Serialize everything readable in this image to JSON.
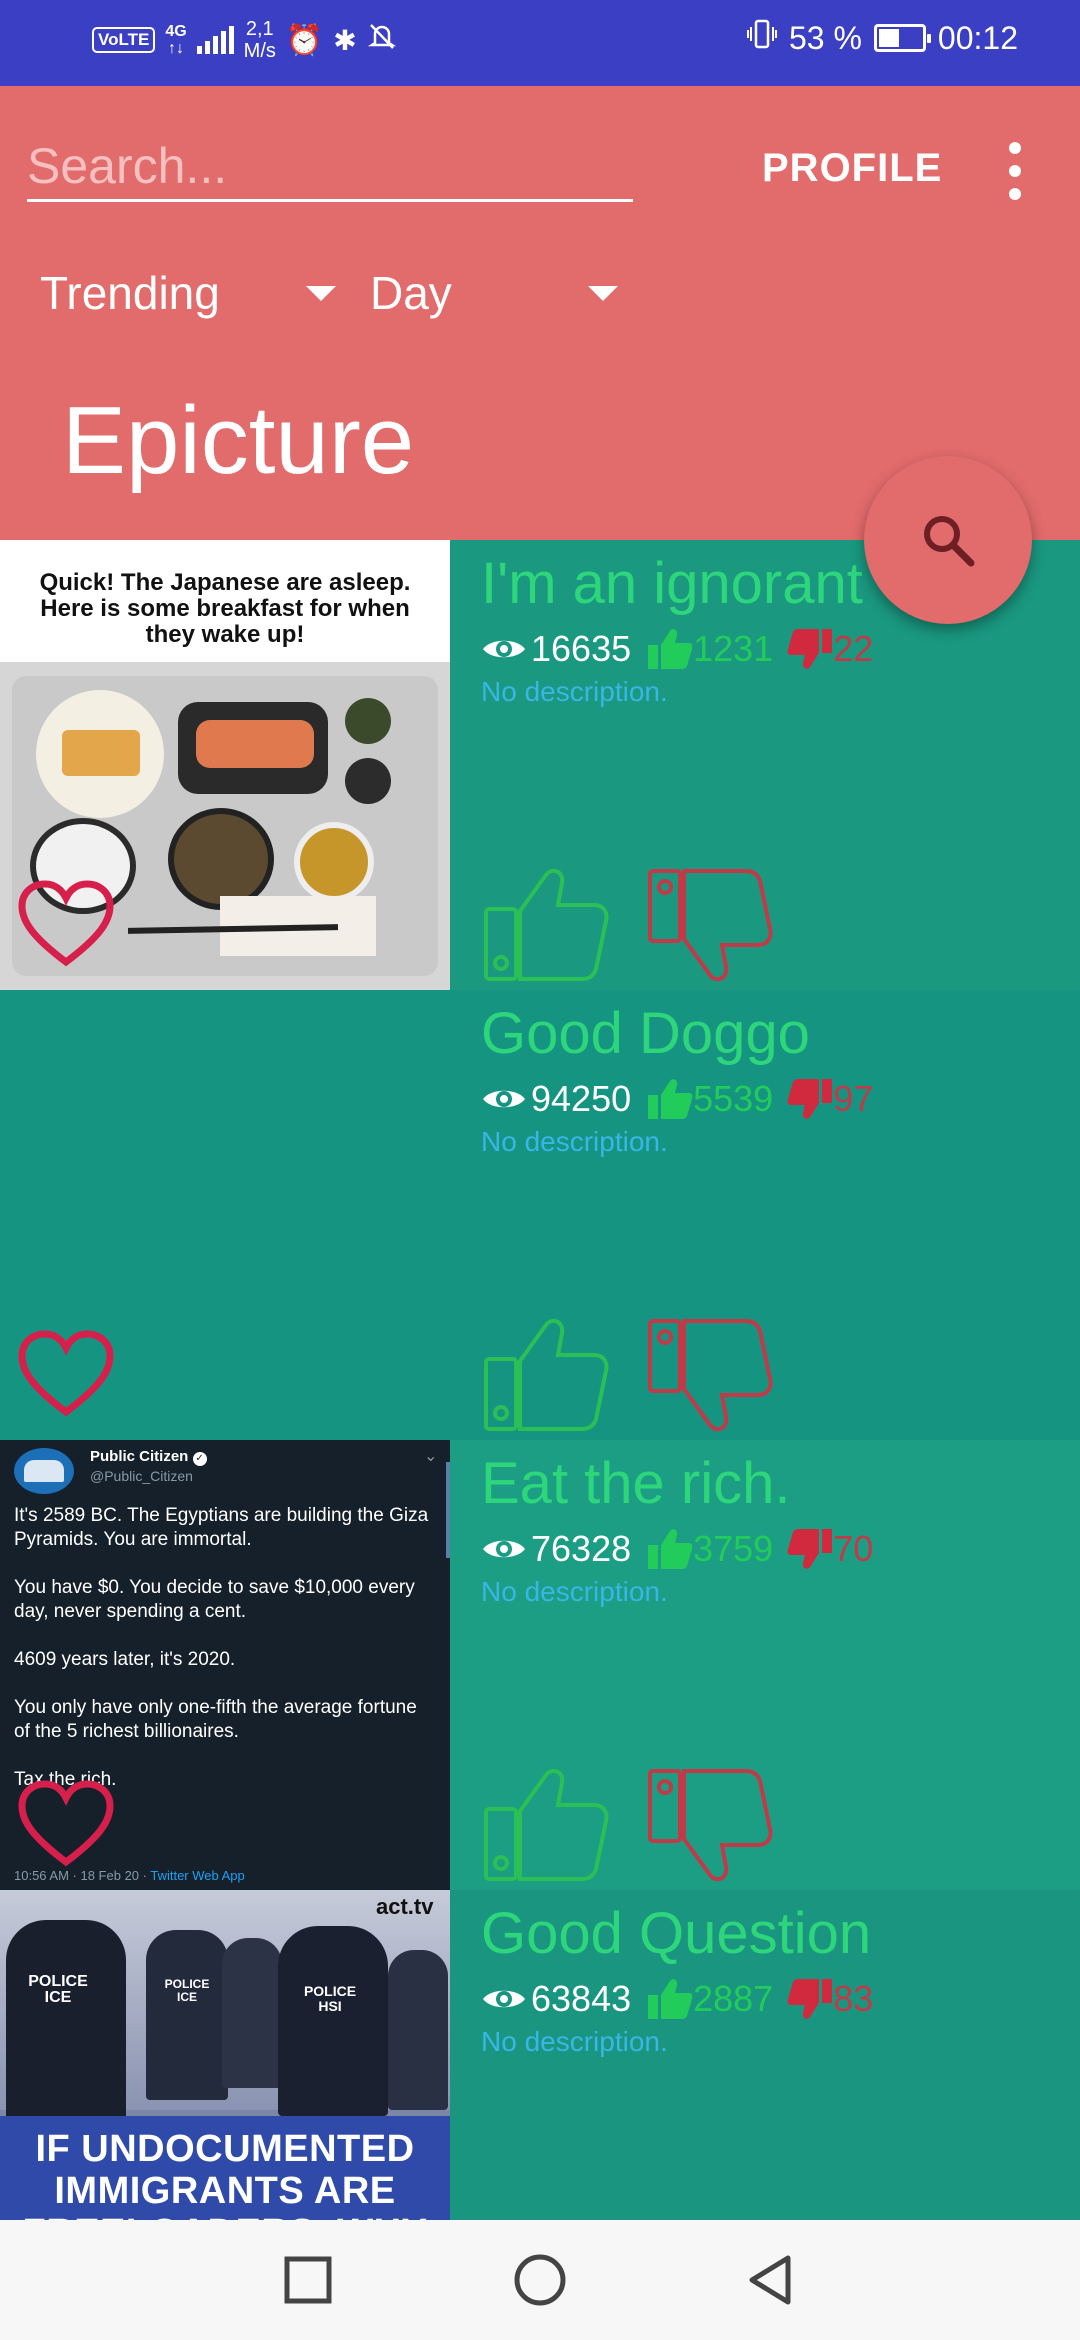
{
  "status_bar": {
    "volte": "VoLTE",
    "network": "4G",
    "speed_value": "2,1",
    "speed_unit": "M/s",
    "battery": "53 %",
    "battery_level": 0.53,
    "time": "00:12"
  },
  "header": {
    "search_placeholder": "Search...",
    "profile_label": "PROFILE",
    "sort_selected": "Trending",
    "window_selected": "Day",
    "app_title": "Epicture"
  },
  "posts": [
    {
      "title": "I'm an ignorant",
      "views": "16635",
      "upvotes": "1231",
      "downvotes": "22",
      "description": "No description.",
      "image_text": "Quick! The Japanese are asleep.  Here is some breakfast for when they wake up!"
    },
    {
      "title": "Good Doggo",
      "views": "94250",
      "upvotes": "5539",
      "downvotes": "97",
      "description": "No description."
    },
    {
      "title": "Eat the rich.",
      "views": "76328",
      "upvotes": "3759",
      "downvotes": "70",
      "description": "No description.",
      "tweet": {
        "name": "Public Citizen",
        "handle": "@Public_Citizen",
        "p1": "It's 2589 BC. The Egyptians are building the Giza Pyramids. You are immortal.",
        "p2": "You have $0. You decide to save $10,000 every day, never spending a cent.",
        "p3": "4609 years later, it's 2020.",
        "p4": "You only have only one-fifth the average fortune of the 5 richest billionaires.",
        "p5": "Tax the rich.",
        "meta": "10:56 AM · 18 Feb 20 · ",
        "source": "Twitter Web App"
      }
    },
    {
      "title": "Good Question",
      "views": "63843",
      "upvotes": "2887",
      "downvotes": "83",
      "description": "No description.",
      "image_text": "IF UNDOCUMENTED IMMIGRANTS ARE FREELOADERS, WHY",
      "watermark": "act.tv",
      "vest_1": "POLICE ICE",
      "vest_2": "POLICE ICE",
      "vest_3": "POLICE HSI"
    }
  ],
  "colors": {
    "header_bg": "#e26b6b",
    "status_bar_bg": "#3b3fc4",
    "list_bg": "#1a9a82",
    "title_green": "#2ed67b",
    "upvote_green": "#22cc5a",
    "downvote_red": "#c23a48",
    "description_blue": "#39b6e6",
    "heart_red": "#d61f4a"
  },
  "icons": [
    "eye-icon",
    "thumbs-up-icon",
    "thumbs-down-icon",
    "heart-icon",
    "search-icon",
    "overflow-menu-icon",
    "nav-recents-icon",
    "nav-home-icon",
    "nav-back-icon"
  ]
}
